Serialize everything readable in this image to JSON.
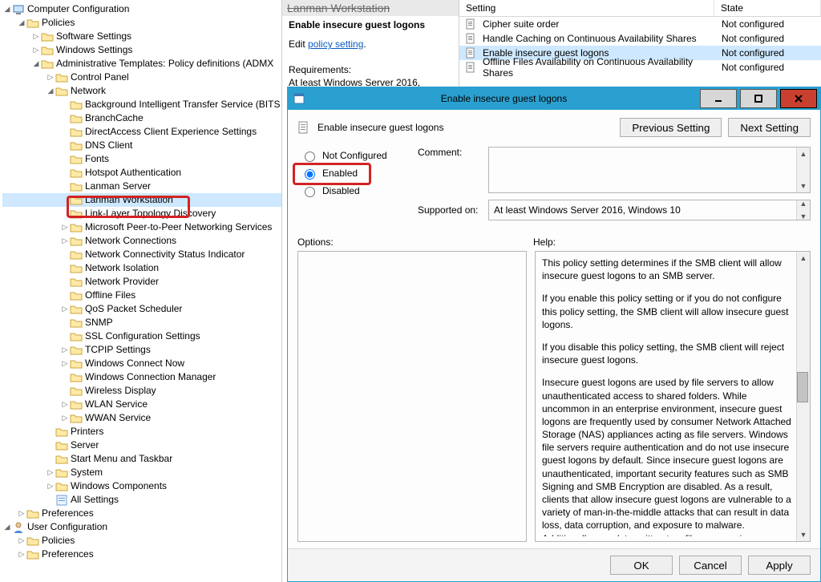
{
  "tree": {
    "root": "Computer Configuration",
    "policies": "Policies",
    "software": "Software Settings",
    "windows": "Windows Settings",
    "admx": "Administrative Templates: Policy definitions (ADMX",
    "cpl": "Control Panel",
    "network": "Network",
    "net_items": [
      "Background Intelligent Transfer Service (BITS",
      "BranchCache",
      "DirectAccess Client Experience Settings",
      "DNS Client",
      "Fonts",
      "Hotspot Authentication",
      "Lanman Server",
      "Lanman Workstation",
      "Link-Layer Topology Discovery",
      "Microsoft Peer-to-Peer Networking Services",
      "Network Connections",
      "Network Connectivity Status Indicator",
      "Network Isolation",
      "Network Provider",
      "Offline Files",
      "QoS Packet Scheduler",
      "SNMP",
      "SSL Configuration Settings",
      "TCPIP Settings",
      "Windows Connect Now",
      "Windows Connection Manager",
      "Wireless Display",
      "WLAN Service",
      "WWAN Service"
    ],
    "printers": "Printers",
    "server": "Server",
    "startmenu": "Start Menu and Taskbar",
    "system": "System",
    "wincomp": "Windows Components",
    "allset": "All Settings",
    "prefs": "Preferences",
    "userconf": "User Configuration",
    "upolicies": "Policies",
    "uprefs": "Preferences"
  },
  "mid": {
    "crumb": "Lanman Workstation",
    "title": "Enable insecure guest logons",
    "edit_prefix": "Edit ",
    "edit_link": "policy setting",
    "suffix": ".",
    "req_lbl": "Requirements:",
    "req_val": "At least Windows Server 2016,"
  },
  "grid": {
    "col_setting": "Setting",
    "col_state": "State",
    "rows": [
      {
        "s": "Cipher suite order",
        "st": "Not configured"
      },
      {
        "s": "Handle Caching on Continuous Availability Shares",
        "st": "Not configured"
      },
      {
        "s": "Enable insecure guest logons",
        "st": "Not configured"
      },
      {
        "s": "Offline Files Availability on Continuous Availability Shares",
        "st": "Not configured"
      }
    ]
  },
  "dlg": {
    "title": "Enable insecure guest logons",
    "header": "Enable insecure guest logons",
    "prev": "Previous Setting",
    "next": "Next Setting",
    "r_notconf": "Not Configured",
    "r_enabled": "Enabled",
    "r_disabled": "Disabled",
    "comment_lbl": "Comment:",
    "comment_val": "",
    "supported_lbl": "Supported on:",
    "supported_val": "At least Windows Server 2016, Windows 10",
    "options_lbl": "Options:",
    "help_lbl": "Help:",
    "help_p1": "This policy setting determines if the SMB client will allow insecure guest logons to an SMB server.",
    "help_p2": "If you enable this policy setting or if you do not configure this policy setting, the SMB client will allow insecure guest logons.",
    "help_p3": "If you disable this policy setting, the SMB client will reject insecure guest logons.",
    "help_p4": "Insecure guest logons are used by file servers to allow unauthenticated access to shared folders. While uncommon in an enterprise environment, insecure guest logons are frequently used by consumer Network Attached Storage (NAS) appliances acting as file servers. Windows file servers require authentication and do not use insecure guest logons by default. Since insecure guest logons are unauthenticated, important security features such as SMB Signing and SMB Encryption are disabled. As a result, clients that allow insecure guest logons are vulnerable to a variety of man-in-the-middle attacks that can result in data loss, data corruption, and exposure to malware. Additionally, any data written to a file server using an insecure guest logon is",
    "ok": "OK",
    "cancel": "Cancel",
    "apply": "Apply"
  }
}
